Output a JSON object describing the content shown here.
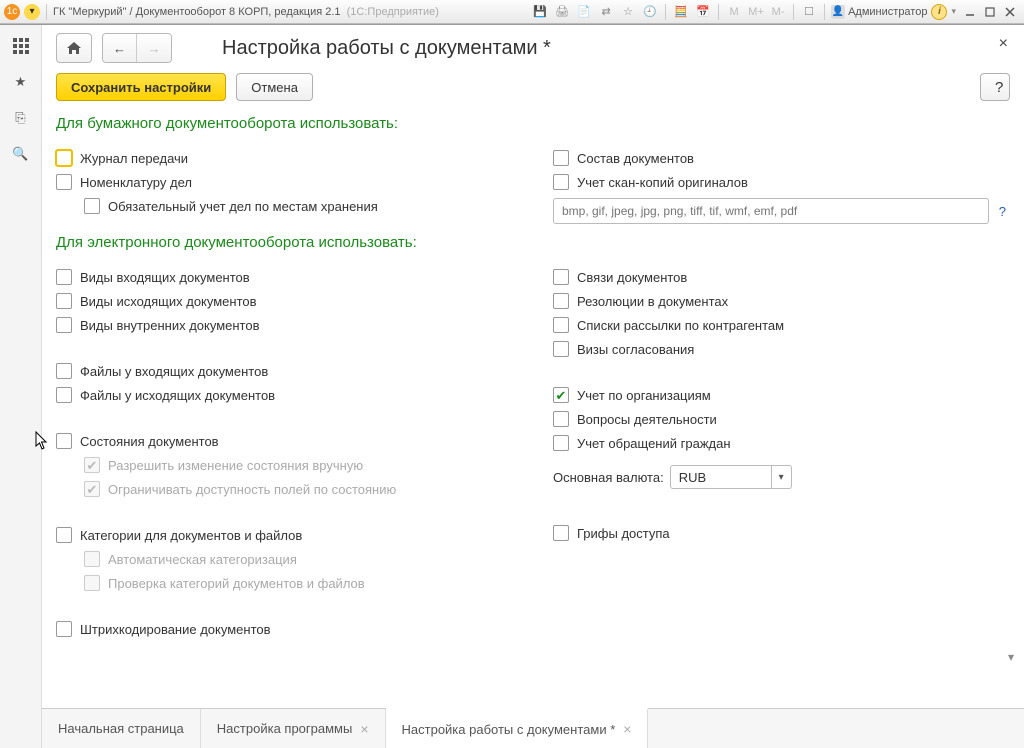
{
  "titlebar": {
    "app_title_main": "ГК \"Меркурий\" / Документооборот 8 КОРП, редакция 2.1",
    "app_title_faded": "(1С:Предприятие)",
    "user_label": "Администратор",
    "m_labels": [
      "M",
      "M+",
      "M-"
    ]
  },
  "page": {
    "title": "Настройка работы с документами *",
    "save_btn": "Сохранить настройки",
    "cancel_btn": "Отмена",
    "help_btn": "?",
    "section1": "Для бумажного документооборота использовать:",
    "section2": "Для электронного документооборота использовать:",
    "left1": [
      {
        "label": "Журнал передачи"
      },
      {
        "label": "Номенклатуру дел"
      },
      {
        "label": "Обязательный учет дел по местам хранения",
        "indent": true
      }
    ],
    "right1": [
      {
        "label": "Состав документов"
      },
      {
        "label": "Учет скан-копий оригиналов"
      }
    ],
    "scan_placeholder": "bmp, gif, jpeg, jpg, png, tiff, tif, wmf, emf, pdf",
    "left2a": [
      {
        "label": "Виды входящих документов"
      },
      {
        "label": "Виды исходящих документов"
      },
      {
        "label": "Виды внутренних документов"
      }
    ],
    "left2b": [
      {
        "label": "Файлы у входящих документов"
      },
      {
        "label": "Файлы у исходящих документов"
      }
    ],
    "left2c_head": {
      "label": "Состояния документов"
    },
    "left2c_sub": [
      {
        "label": "Разрешить изменение состояния вручную"
      },
      {
        "label": "Ограничивать доступность полей по состоянию"
      }
    ],
    "left2d_head": {
      "label": "Категории для документов и файлов"
    },
    "left2d_sub": [
      {
        "label": "Автоматическая категоризация"
      },
      {
        "label": "Проверка категорий документов и файлов"
      }
    ],
    "left2e": {
      "label": "Штрихкодирование документов"
    },
    "right2a": [
      {
        "label": "Связи документов"
      },
      {
        "label": "Резолюции в документах"
      },
      {
        "label": "Списки рассылки по контрагентам"
      },
      {
        "label": "Визы согласования"
      }
    ],
    "right2b": [
      {
        "label": "Учет по организациям",
        "checked": true
      },
      {
        "label": "Вопросы деятельности"
      },
      {
        "label": "Учет обращений граждан"
      }
    ],
    "currency_label": "Основная валюта:",
    "currency_value": "RUB",
    "right2c": {
      "label": "Грифы доступа"
    }
  },
  "tabs": [
    {
      "label": "Начальная страница",
      "closable": false,
      "active": false
    },
    {
      "label": "Настройка программы",
      "closable": true,
      "active": false
    },
    {
      "label": "Настройка работы с документами *",
      "closable": true,
      "active": true
    }
  ]
}
